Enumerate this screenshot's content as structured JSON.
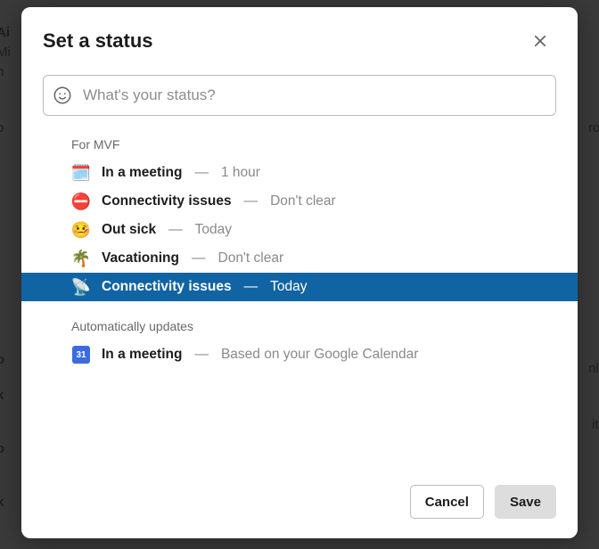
{
  "modal": {
    "title": "Set a status",
    "input_placeholder": "What's your status?",
    "section_for": "For MVF",
    "section_auto": "Automatically updates",
    "cancel_label": "Cancel",
    "save_label": "Save"
  },
  "statuses": [
    {
      "icon": "🗓️",
      "label": "In a meeting",
      "duration": "1 hour",
      "selected": false
    },
    {
      "icon": "⛔",
      "label": "Connectivity issues",
      "duration": "Don't clear",
      "selected": false
    },
    {
      "icon": "🤒",
      "label": "Out sick",
      "duration": "Today",
      "selected": false
    },
    {
      "icon": "🌴",
      "label": "Vacationing",
      "duration": "Don't clear",
      "selected": false
    },
    {
      "icon": "📡",
      "label": "Connectivity issues",
      "duration": "Today",
      "selected": true
    }
  ],
  "auto_statuses": [
    {
      "icon": "31",
      "label": "In a meeting",
      "duration": "Based on your Google Calendar"
    }
  ]
}
